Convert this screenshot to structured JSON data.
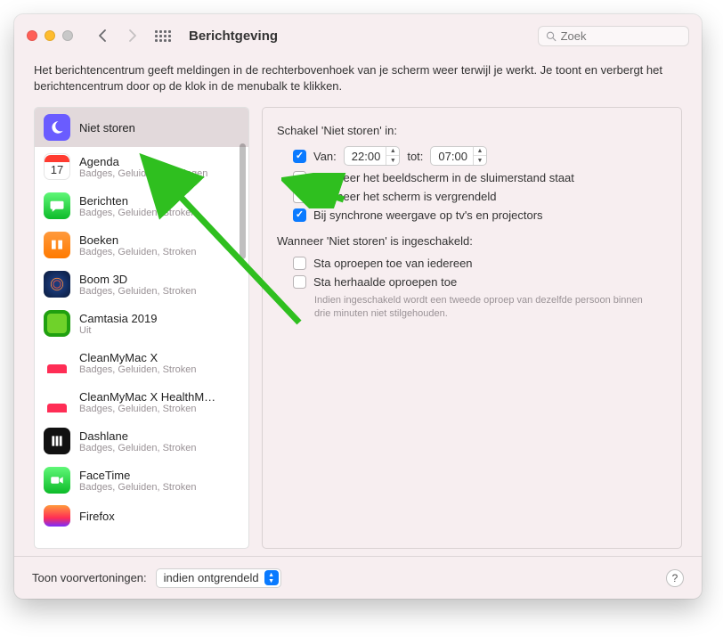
{
  "titlebar": {
    "title": "Berichtgeving",
    "search_placeholder": "Zoek"
  },
  "description": "Het berichtencentrum geeft meldingen in de rechterbovenhoek van je scherm weer terwijl je werkt. Je toont en verbergt het berichtencentrum door op de klok in de menubalk te klikken.",
  "sidebar": {
    "items": [
      {
        "name": "Niet storen",
        "sub": ""
      },
      {
        "name": "Agenda",
        "sub": "Badges, Geluiden, Meldingen"
      },
      {
        "name": "Berichten",
        "sub": "Badges, Geluiden, Stroken"
      },
      {
        "name": "Boeken",
        "sub": "Badges, Geluiden, Stroken"
      },
      {
        "name": "Boom 3D",
        "sub": "Badges, Geluiden, Stroken"
      },
      {
        "name": "Camtasia 2019",
        "sub": "Uit"
      },
      {
        "name": "CleanMyMac X",
        "sub": "Badges, Geluiden, Stroken"
      },
      {
        "name": "CleanMyMac X HealthM…",
        "sub": "Badges, Geluiden, Stroken"
      },
      {
        "name": "Dashlane",
        "sub": "Badges, Geluiden, Stroken"
      },
      {
        "name": "FaceTime",
        "sub": "Badges, Geluiden, Stroken"
      },
      {
        "name": "Firefox",
        "sub": ""
      }
    ],
    "cal_day": "17"
  },
  "detail": {
    "section1_title": "Schakel 'Niet storen' in:",
    "from_label": "Van:",
    "from_time": "22:00",
    "to_label": "tot:",
    "to_time": "07:00",
    "opt_sleep": "Wanneer het beeldscherm in de sluimerstand staat",
    "opt_locked": "Wanneer het scherm is vergrendeld",
    "opt_mirror": "Bij synchrone weergave op tv's en projectors",
    "section2_title": "Wanneer 'Niet storen' is ingeschakeld:",
    "opt_calls_everyone": "Sta oproepen toe van iedereen",
    "opt_repeated": "Sta herhaalde oproepen toe",
    "repeated_hint": "Indien ingeschakeld wordt een tweede oproep van dezelfde persoon binnen drie minuten niet stilgehouden."
  },
  "footer": {
    "preview_label": "Toon voorvertoningen:",
    "preview_value": "indien ontgrendeld",
    "help": "?"
  }
}
